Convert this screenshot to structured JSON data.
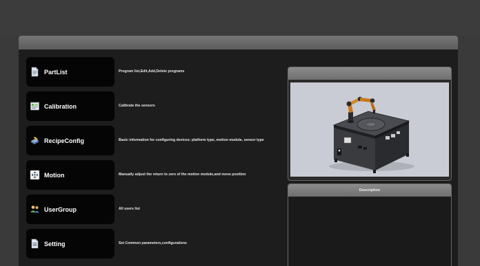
{
  "menu": {
    "items": [
      {
        "id": "partlist",
        "label": "PartList",
        "icon": "document-icon",
        "description": "Program list,Edit,Add,Delete programs"
      },
      {
        "id": "calibration",
        "label": "Calibration",
        "icon": "calibration-sheet-icon",
        "description": "Calibrate the sensors"
      },
      {
        "id": "recipeconfig",
        "label": "RecipeConfig",
        "icon": "recipe-edit-icon",
        "description": "Basic information for configuring devices: platform type, motion module, sensor type"
      },
      {
        "id": "motion",
        "label": "Motion",
        "icon": "motion-arrows-icon",
        "description": "Manually adjust the return to zero of the motion module,and move position"
      },
      {
        "id": "usergroup",
        "label": "UserGroup",
        "icon": "users-icon",
        "description": "All users list"
      },
      {
        "id": "setting",
        "label": "Setting",
        "icon": "settings-document-icon",
        "description": "Set Common parameters,configurations"
      }
    ]
  },
  "description_panel": {
    "title": "Description"
  },
  "colors": {
    "background": "#3a3a3a",
    "menu_button": "#050505",
    "preview_backdrop": "#c9ccd4",
    "robot_arm": "#c8781e"
  }
}
